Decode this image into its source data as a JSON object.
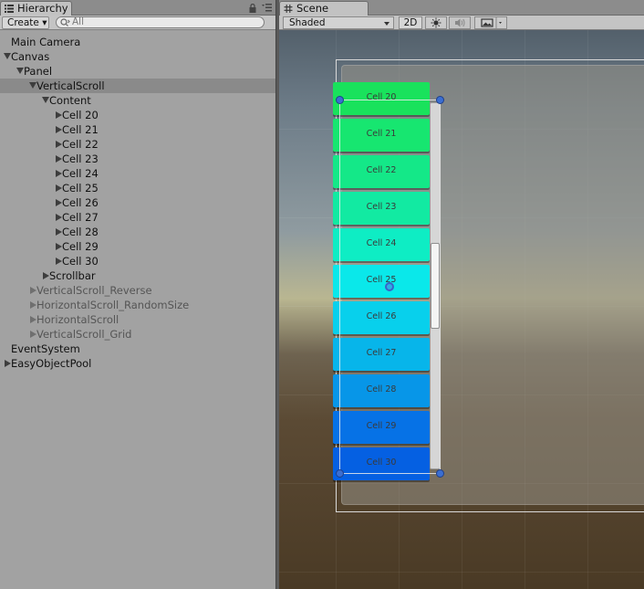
{
  "hierarchy": {
    "tab_title": "Hierarchy",
    "create_label": "Create ▾",
    "search_placeholder": "All",
    "rows": [
      {
        "label": "Main Camera",
        "depth": 0,
        "arrow": "none",
        "selected": false,
        "dim": false
      },
      {
        "label": "Canvas",
        "depth": 0,
        "arrow": "down",
        "selected": false,
        "dim": false
      },
      {
        "label": "Panel",
        "depth": 1,
        "arrow": "down",
        "selected": false,
        "dim": false
      },
      {
        "label": "VerticalScroll",
        "depth": 2,
        "arrow": "down",
        "selected": true,
        "dim": false
      },
      {
        "label": "Content",
        "depth": 3,
        "arrow": "down",
        "selected": false,
        "dim": false
      },
      {
        "label": "Cell 20",
        "depth": 4,
        "arrow": "right",
        "selected": false,
        "dim": false
      },
      {
        "label": "Cell 21",
        "depth": 4,
        "arrow": "right",
        "selected": false,
        "dim": false
      },
      {
        "label": "Cell 22",
        "depth": 4,
        "arrow": "right",
        "selected": false,
        "dim": false
      },
      {
        "label": "Cell 23",
        "depth": 4,
        "arrow": "right",
        "selected": false,
        "dim": false
      },
      {
        "label": "Cell 24",
        "depth": 4,
        "arrow": "right",
        "selected": false,
        "dim": false
      },
      {
        "label": "Cell 25",
        "depth": 4,
        "arrow": "right",
        "selected": false,
        "dim": false
      },
      {
        "label": "Cell 26",
        "depth": 4,
        "arrow": "right",
        "selected": false,
        "dim": false
      },
      {
        "label": "Cell 27",
        "depth": 4,
        "arrow": "right",
        "selected": false,
        "dim": false
      },
      {
        "label": "Cell 28",
        "depth": 4,
        "arrow": "right",
        "selected": false,
        "dim": false
      },
      {
        "label": "Cell 29",
        "depth": 4,
        "arrow": "right",
        "selected": false,
        "dim": false
      },
      {
        "label": "Cell 30",
        "depth": 4,
        "arrow": "right",
        "selected": false,
        "dim": false
      },
      {
        "label": "Scrollbar",
        "depth": 3,
        "arrow": "right",
        "selected": false,
        "dim": false
      },
      {
        "label": "VerticalScroll_Reverse",
        "depth": 2,
        "arrow": "right",
        "selected": false,
        "dim": true
      },
      {
        "label": "HorizontalScroll_RandomSize",
        "depth": 2,
        "arrow": "right",
        "selected": false,
        "dim": true
      },
      {
        "label": "HorizontalScroll",
        "depth": 2,
        "arrow": "right",
        "selected": false,
        "dim": true
      },
      {
        "label": "VerticalScroll_Grid",
        "depth": 2,
        "arrow": "right",
        "selected": false,
        "dim": true
      },
      {
        "label": "EventSystem",
        "depth": 0,
        "arrow": "none",
        "selected": false,
        "dim": false
      },
      {
        "label": "EasyObjectPool",
        "depth": 0,
        "arrow": "right",
        "selected": false,
        "dim": false
      }
    ]
  },
  "scene": {
    "tab_title": "Scene",
    "shading_mode": "Shaded",
    "mode_2d_label": "2D",
    "cells": [
      {
        "label": "Cell 20",
        "color": "#19e25c"
      },
      {
        "label": "Cell 21",
        "color": "#17e670"
      },
      {
        "label": "Cell 22",
        "color": "#14e888"
      },
      {
        "label": "Cell 23",
        "color": "#12eaa2"
      },
      {
        "label": "Cell 24",
        "color": "#0eedc4"
      },
      {
        "label": "Cell 25",
        "color": "#0ae8ea"
      },
      {
        "label": "Cell 26",
        "color": "#08d0ec"
      },
      {
        "label": "Cell 27",
        "color": "#07b5ea"
      },
      {
        "label": "Cell 28",
        "color": "#0796e8"
      },
      {
        "label": "Cell 29",
        "color": "#0672e6"
      },
      {
        "label": "Cell 30",
        "color": "#0560e2"
      }
    ],
    "scroll_position": 0.5
  }
}
